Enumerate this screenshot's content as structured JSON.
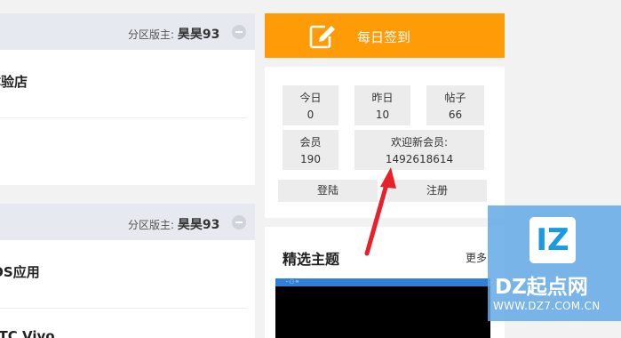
{
  "colors": {
    "accent": "#fe9b07",
    "arrow": "#e8202a",
    "watermark": "#64aae6"
  },
  "forum_sections": [
    {
      "moderator_label": "分区版主:",
      "moderator_name": "昊昊93",
      "forums": [
        "体验店"
      ]
    },
    {
      "moderator_label": "分区版主:",
      "moderator_name": "昊昊93",
      "forums": [
        "iOS应用",
        "HTC Vivo"
      ]
    }
  ],
  "checkin": {
    "label": "每日签到",
    "icon": "edit-icon"
  },
  "stats": {
    "today": {
      "label": "今日",
      "value": "0"
    },
    "yesterday": {
      "label": "昨日",
      "value": "10"
    },
    "posts": {
      "label": "帖子",
      "value": "66"
    },
    "members": {
      "label": "会员",
      "value": "190"
    },
    "new_member": {
      "label": "欢迎新会员:",
      "value": "1492618614"
    }
  },
  "auth": {
    "login": "登陆",
    "register": "注册"
  },
  "featured": {
    "title": "精选主题",
    "more": "更多"
  },
  "watermark": {
    "logo_letters": "IZ",
    "name": "DZ起点网",
    "url": "WWW.DZ7.COM.CN"
  }
}
